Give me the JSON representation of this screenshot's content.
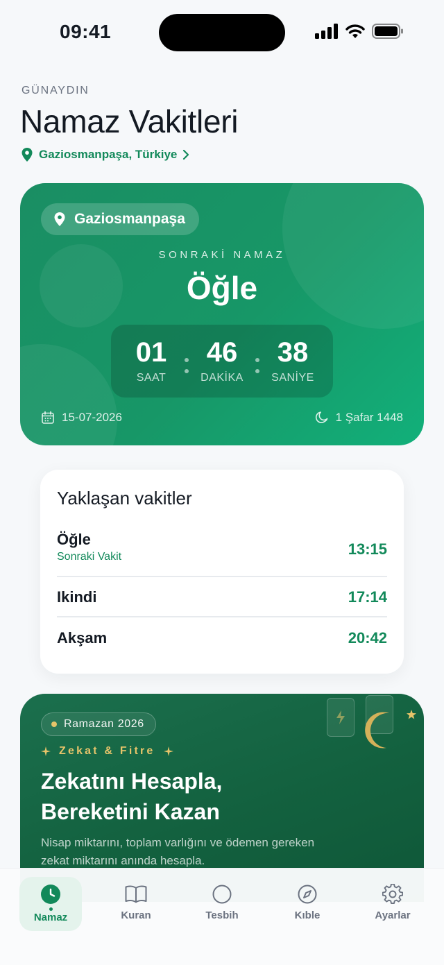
{
  "status_bar": {
    "time": "09:41"
  },
  "header": {
    "greeting": "GÜNAYDIN",
    "title": "Namaz Vakitleri",
    "location": "Gaziosmanpaşa, Türkiye"
  },
  "hero": {
    "location_chip": "Gaziosmanpaşa",
    "next_label": "SONRAKİ NAMAZ",
    "next_prayer": "Öğle",
    "countdown": {
      "hours": "01",
      "hours_label": "SAAT",
      "minutes": "46",
      "minutes_label": "DAKİKA",
      "seconds": "38",
      "seconds_label": "SANİYE"
    },
    "gregorian_date": "15-07-2026",
    "hijri_date": "1 Şafar 1448"
  },
  "upcoming": {
    "title": "Yaklaşan vakitler",
    "rows": [
      {
        "name": "Öğle",
        "subtitle": "Sonraki Vakit",
        "time": "13:15"
      },
      {
        "name": "Ikindi",
        "time": "17:14"
      },
      {
        "name": "Akşam",
        "time": "20:42"
      }
    ]
  },
  "promo": {
    "chip": "Ramazan 2026",
    "kicker": "Zekat & Fitre",
    "title_line1": "Zekatını Hesapla,",
    "title_line2": "Bereketini Kazan",
    "description": "Nisap miktarını, toplam varlığını ve ödemen gereken zekat miktarını anında hesapla."
  },
  "tabs": [
    {
      "label": "Namaz",
      "icon": "clock-icon",
      "active": true
    },
    {
      "label": "Kuran",
      "icon": "book-icon",
      "active": false
    },
    {
      "label": "Tesbih",
      "icon": "circle-icon",
      "active": false
    },
    {
      "label": "Kıble",
      "icon": "compass-icon",
      "active": false
    },
    {
      "label": "Ayarlar",
      "icon": "gear-icon",
      "active": false
    }
  ],
  "colors": {
    "accent": "#12895A",
    "hero_gradient_start": "#1A8E63",
    "hero_gradient_end": "#12B07A",
    "promo_bg": "#13613F",
    "gold": "#E7C46A",
    "background": "#F6F8FA"
  }
}
